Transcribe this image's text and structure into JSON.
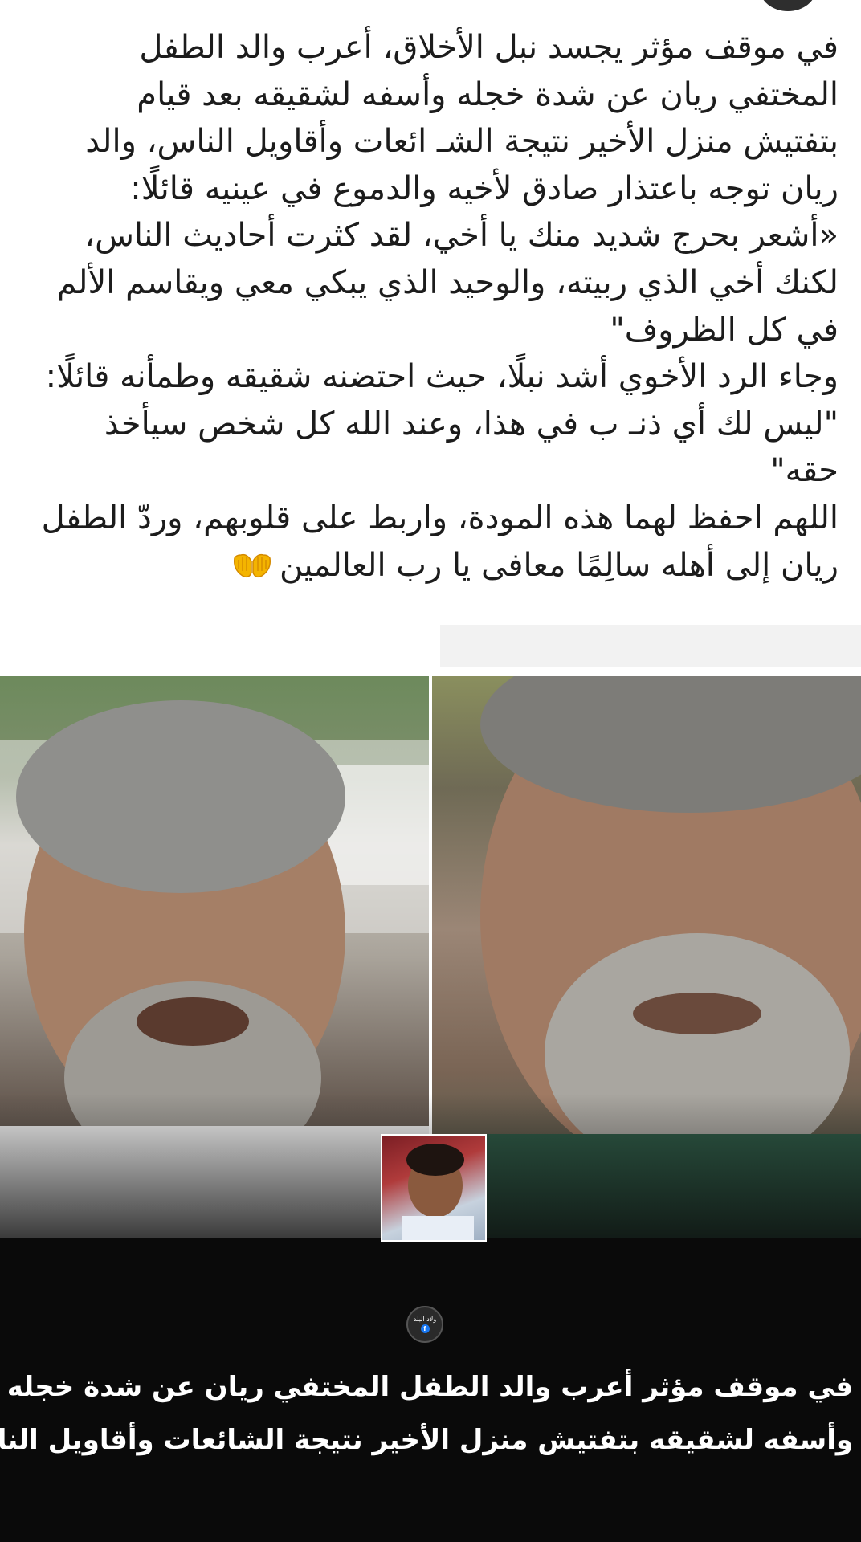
{
  "post": {
    "paragraphs": [
      "في موقف مؤثر يجسد نبل الأخلاق، أعرب والد الطفل المختفي ريان عن شدة خجله وأسفه لشقيقه بعد قيام بتفتيش منزل الأخير نتيجة الشـ ائعات وأقاويل الناس، والد ريان توجه باعتذار صادق لأخيه والدموع في عينيه قائلًا:",
      "«أشعر بحرج شديد منك يا أخي، لقد كثرت أحاديث الناس، لكنك أخي الذي ربيته، والوحيد الذي يبكي معي ويقاسم الألم في كل الظروف\"",
      "وجاء الرد الأخوي أشد نبلًا، حيث احتضنه شقيقه وطمأنه قائلًا:",
      "\"ليس لك أي ذنـ ب في هذا، وعند الله كل شخص سيأخذ حقه\"",
      "اللهم احفظ لهما هذه المودة، واربط على قلوبهم، وردّ الطفل ريان إلى أهله سالِمًا معافى يا رب العالمين"
    ],
    "emoji": "palms-up-together-icon"
  },
  "image": {
    "channel_logo_text": "ولاد البلد",
    "caption_lines": [
      "في موقف مؤثر أعرب والد الطفل المختفي ريان عن شدة خجله",
      "وأسفه لشقيقه بتفتيش منزل الأخير نتيجة الشائعات وأقاويل الناس"
    ]
  },
  "colors": {
    "text": "#1c1c1c",
    "caption": "#ffffff",
    "image_bg": "#0a0a0a",
    "facebook_blue": "#1877f2"
  }
}
